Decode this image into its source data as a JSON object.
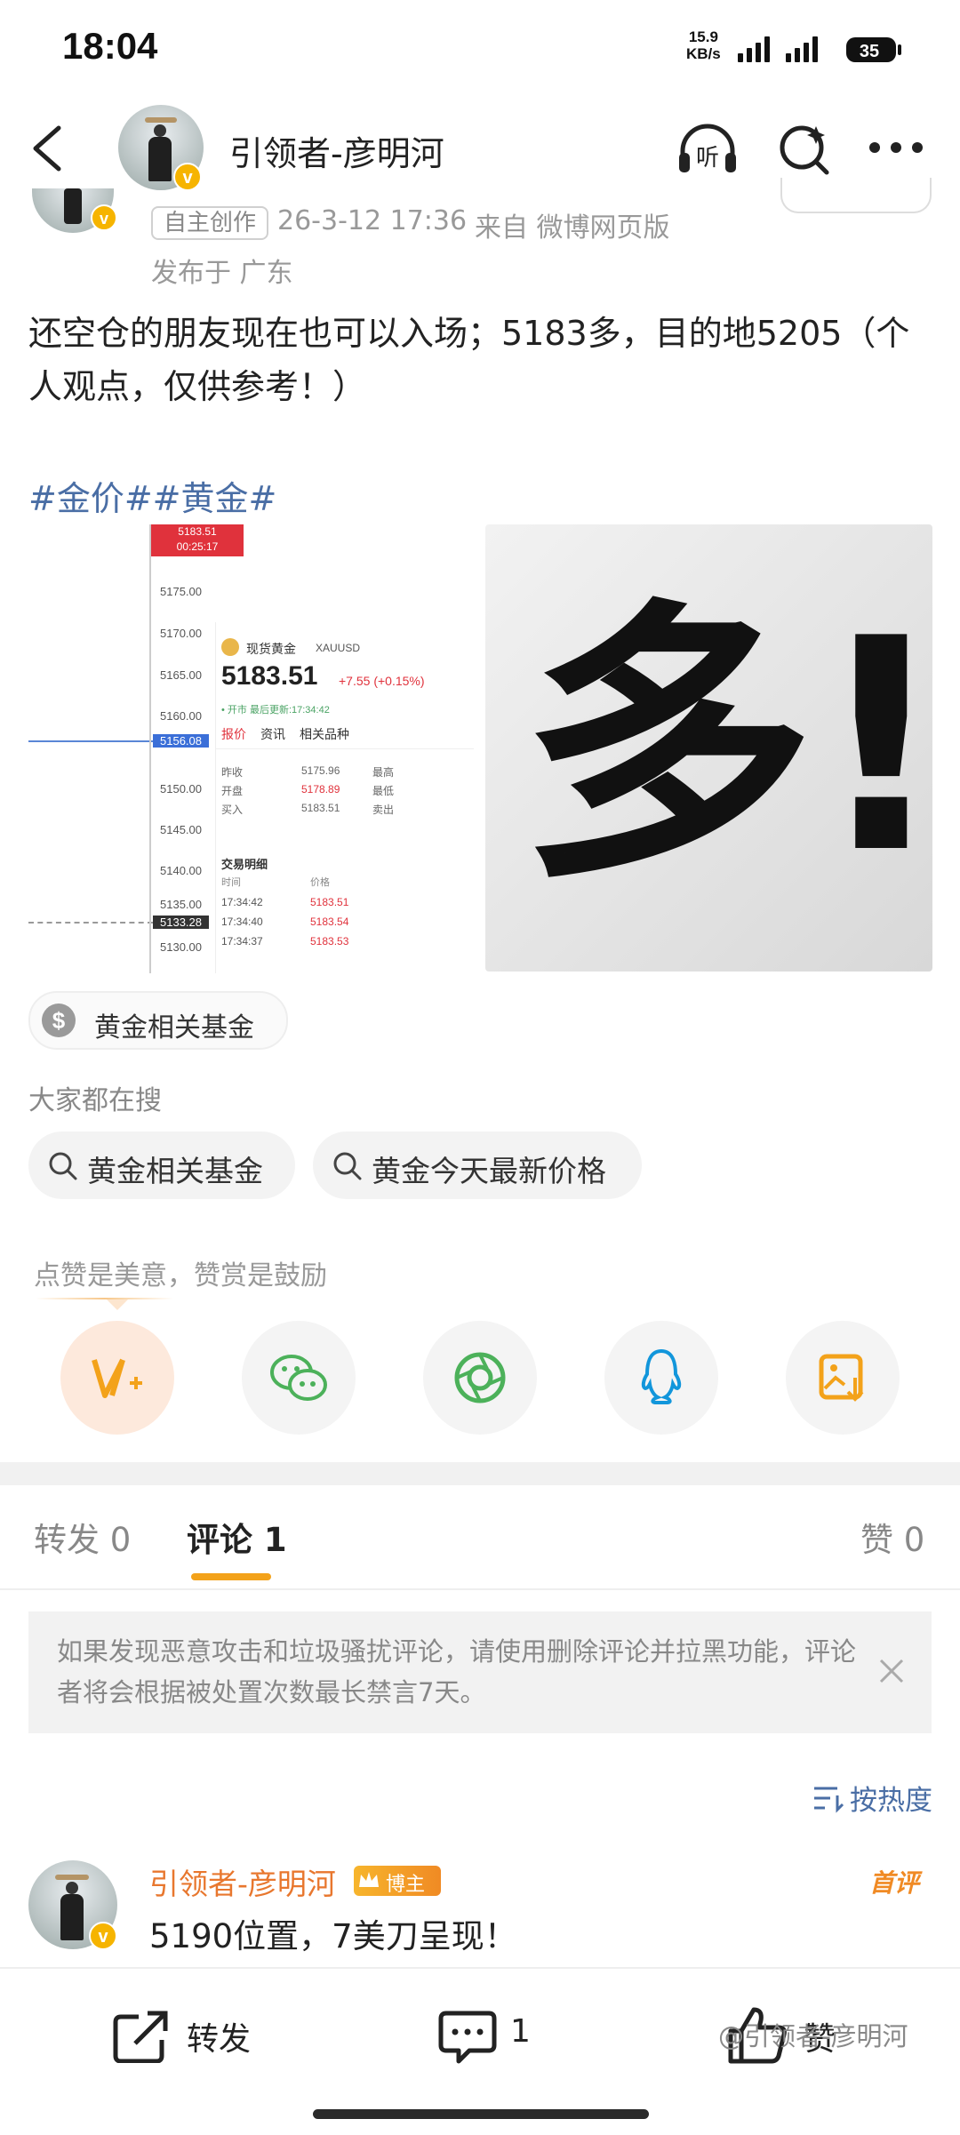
{
  "status_bar": {
    "time": "18:04",
    "net_speed_value": "15.9",
    "net_speed_unit": "KB/s",
    "battery": "35"
  },
  "header": {
    "title": "引领者-彦明河",
    "icons": [
      "back-arrow-icon",
      "listen-icon",
      "search-icon",
      "more-icon"
    ],
    "listen_label": "听"
  },
  "post": {
    "tag": "自主创作",
    "time": "26-3-12 17:36",
    "source": "来自 微博网页版",
    "location": "发布于 广东",
    "body": "还空仓的朋友现在也可以入场；5183多，目的地5205（个人观点，仅供参考！）",
    "hashtags": "#金价##黄金#",
    "image_left": {
      "price_labels": [
        "5183.51",
        "00:25:17",
        "5175.00",
        "5170.00",
        "5165.00",
        "5160.00",
        "5156.08",
        "5150.00",
        "5145.00",
        "5140.00",
        "5135.00",
        "5133.28",
        "5130.00"
      ],
      "instrument_name": "现货黄金",
      "instrument_code": "XAUUSD",
      "price": "5183.51",
      "change": "+7.55 (+0.15%)",
      "status_line": "• 开市 最后更新:17:34:42",
      "tabs": [
        "报价",
        "资讯",
        "相关品种"
      ],
      "quote_rows": [
        {
          "label": "昨收",
          "value": "5175.96",
          "label2": "最高"
        },
        {
          "label": "开盘",
          "value": "5178.89",
          "label2": "最低"
        },
        {
          "label": "买入",
          "value": "5183.51",
          "label2": "卖出"
        }
      ],
      "trade_title": "交易明细",
      "trade_headers": [
        "时间",
        "价格"
      ],
      "trades": [
        {
          "time": "17:34:42",
          "price": "5183.51"
        },
        {
          "time": "17:34:40",
          "price": "5183.54"
        },
        {
          "time": "17:34:37",
          "price": "5183.53"
        }
      ]
    },
    "image_right": {
      "text": "多!"
    }
  },
  "fund_chip": {
    "label": "黄金相关基金",
    "icon": "dollar-icon"
  },
  "search": {
    "heading": "大家都在搜",
    "items": [
      {
        "label": "黄金相关基金"
      },
      {
        "label": "黄金今天最新价格"
      }
    ]
  },
  "like_hint": "点赞是美意，赞赏是鼓励",
  "share_icons": [
    "vplus-icon",
    "wechat-icon",
    "moments-icon",
    "qq-icon",
    "save-image-icon"
  ],
  "tabs": {
    "repost": "转发 0",
    "comment": "评论 1",
    "like": "赞 0"
  },
  "notice": "如果发现恶意攻击和垃圾骚扰评论，请使用删除评论并拉黑功能，评论者将会根据被处置次数最长禁言7天。",
  "sort_label": "按热度",
  "comment": {
    "name": "引领者-彦明河",
    "badge": "博主",
    "text": "5190位置，7美刀呈现！",
    "tag": "首评"
  },
  "bottom_bar": {
    "repost": "转发",
    "comment_count": "1",
    "like": "赞"
  },
  "watermark": "@引领者-彦明河",
  "colors": {
    "accent_orange": "#f3a21a",
    "link_blue": "#4a6ea5",
    "name_orange": "#e8772e"
  }
}
